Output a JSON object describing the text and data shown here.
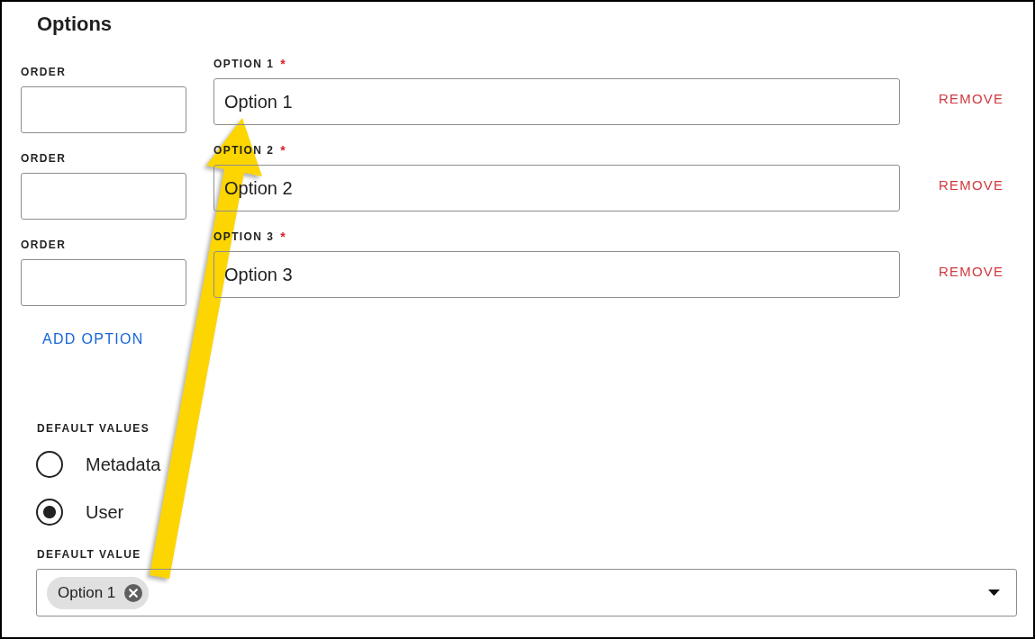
{
  "section": {
    "title": "Options"
  },
  "options": [
    {
      "order_label": "ORDER",
      "label": "OPTION 1",
      "required_mark": "*",
      "value": "Option 1",
      "remove": "REMOVE"
    },
    {
      "order_label": "ORDER",
      "label": "OPTION 2",
      "required_mark": "*",
      "value": "Option 2",
      "remove": "REMOVE"
    },
    {
      "order_label": "ORDER",
      "label": "OPTION 3",
      "required_mark": "*",
      "value": "Option 3",
      "remove": "REMOVE"
    }
  ],
  "add_option": "ADD OPTION",
  "default_values": {
    "label": "DEFAULT VALUES",
    "choices": [
      {
        "label": "Metadata",
        "selected": false
      },
      {
        "label": "User",
        "selected": true
      }
    ]
  },
  "default_value": {
    "label": "DEFAULT VALUE",
    "chips": [
      {
        "label": "Option 1"
      }
    ]
  }
}
